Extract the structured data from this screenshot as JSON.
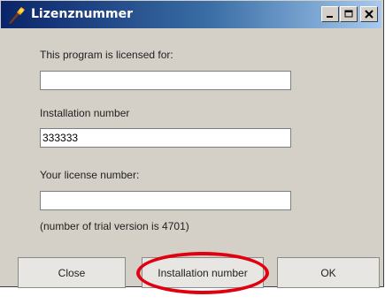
{
  "window": {
    "title": "Lizenznummer",
    "controls": {
      "minimize": "_",
      "maximize": "□",
      "close": "X"
    }
  },
  "form": {
    "licensed_for_label": "This program is licensed for:",
    "licensed_for_value": "",
    "installation_label": "Installation number",
    "installation_value": "333333",
    "license_label": "Your license number:",
    "license_value": "",
    "trial_note": "(number of trial version is 4701)"
  },
  "buttons": {
    "close": "Close",
    "installation": "Installation number",
    "ok": "OK"
  },
  "annotation": {
    "highlight_color": "#e0000f"
  }
}
